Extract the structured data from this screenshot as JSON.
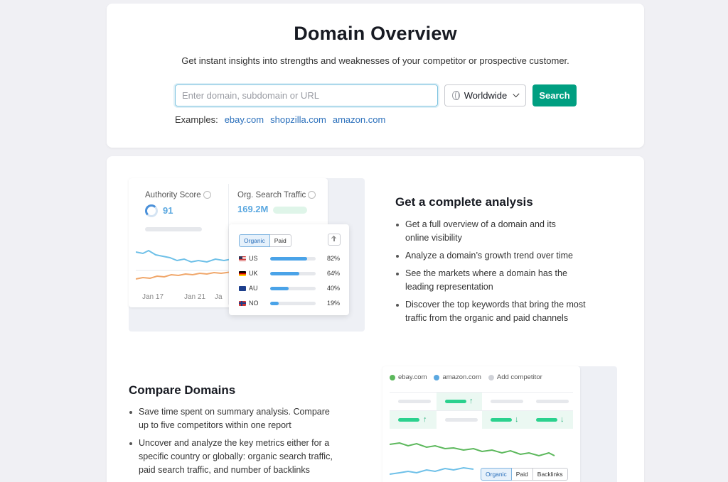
{
  "hero": {
    "title": "Domain Overview",
    "subtitle": "Get instant insights into strengths and weaknesses of your competitor or prospective customer.",
    "search_placeholder": "Enter domain, subdomain or URL",
    "region": "Worldwide",
    "search_button": "Search",
    "examples_label": "Examples:",
    "examples": [
      "ebay.com",
      "shopzilla.com",
      "amazon.com"
    ]
  },
  "analysis": {
    "title": "Get a complete analysis",
    "bullets": [
      "Get a full overview of a domain and its online visibility",
      "Analyze a domain’s growth trend over time",
      "See the markets where a domain has the leading representation",
      "Discover the top keywords that bring the most traffic from the organic and paid channels"
    ],
    "mockup": {
      "authority_label": "Authority Score",
      "authority_value": "91",
      "traffic_label": "Org. Search Traffic",
      "traffic_value": "169.2M",
      "dates": [
        "Jan 17",
        "Jan 21",
        "Ja"
      ],
      "tabs": [
        "Organic",
        "Paid"
      ],
      "countries": [
        {
          "code": "US",
          "pct": "82%",
          "share": 0.82
        },
        {
          "code": "UK",
          "pct": "64%",
          "share": 0.64
        },
        {
          "code": "AU",
          "pct": "40%",
          "share": 0.4
        },
        {
          "code": "NO",
          "pct": "19%",
          "share": 0.19
        }
      ]
    }
  },
  "compare": {
    "title": "Compare Domains",
    "bullets": [
      "Save time spent on summary analysis. Compare up to five competitors within one report",
      "Uncover and analyze the key metrics either for a specific country or globally: organic search traffic, paid search traffic, and number of backlinks"
    ],
    "mockup": {
      "legend": [
        "ebay.com",
        "amazon.com",
        "Add competitor"
      ],
      "tabs": [
        "Organic",
        "Paid",
        "Backlinks"
      ]
    }
  },
  "colors": {
    "accent_green": "#009f81",
    "link_blue": "#2a6fbb",
    "series_blue": "#5ba8e0",
    "series_green": "#5cb85c"
  }
}
